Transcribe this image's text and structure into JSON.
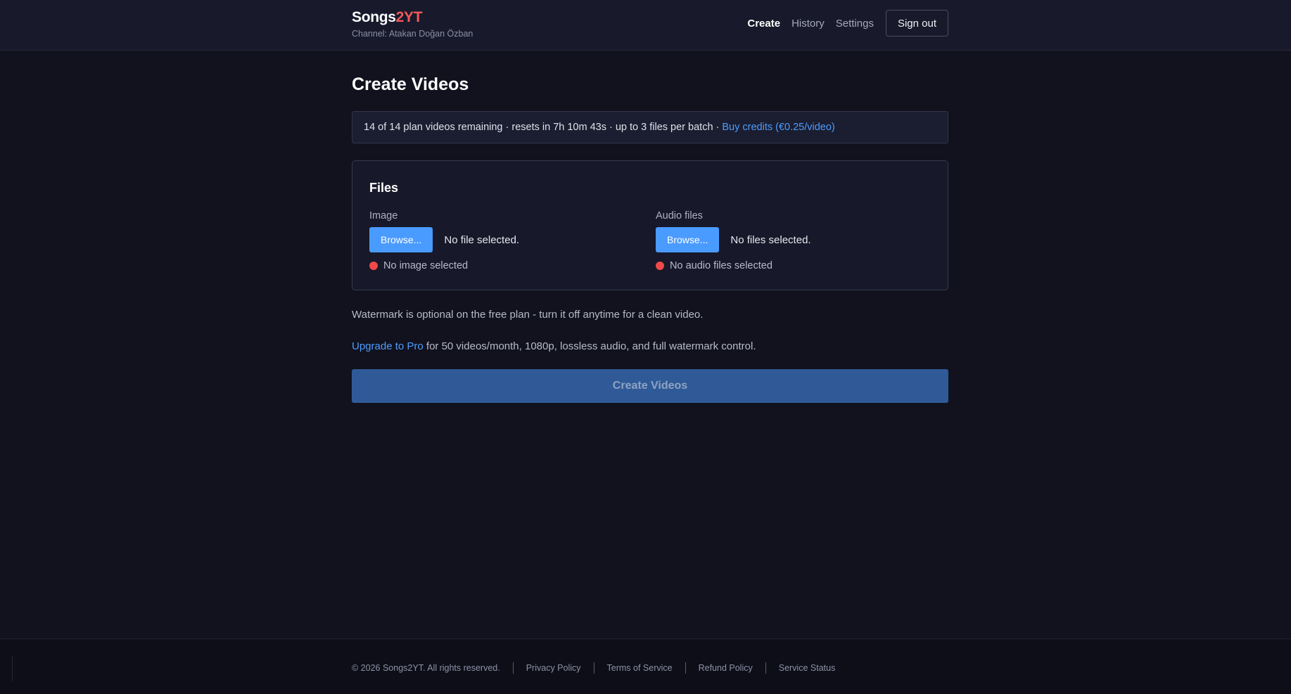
{
  "header": {
    "brand_main": "Songs",
    "brand_accent": "2YT",
    "channel": "Channel: Atakan Doğan Özban",
    "nav": [
      "Create",
      "History",
      "Settings"
    ],
    "sign_out": "Sign out"
  },
  "main": {
    "title": "Create Videos",
    "quota_text": "14 of 14 plan videos remaining · resets in 7h 10m 43s · up to 3 files per batch ·",
    "quota_link": "Buy credits (€0.25/video)",
    "files": {
      "title": "Files",
      "image": {
        "label": "Image",
        "browse": "Browse...",
        "status": "No file selected.",
        "warning": "No image selected"
      },
      "audio": {
        "label": "Audio files",
        "browse": "Browse...",
        "status": "No files selected.",
        "warning": "No audio files selected"
      }
    },
    "watermark_note": "Watermark is optional on the free plan - turn it off anytime for a clean video.",
    "upgrade_link": "Upgrade to Pro",
    "upgrade_text": " for 50 videos/month, 1080p, lossless audio, and full watermark control.",
    "create_button": "Create Videos"
  },
  "footer": {
    "copyright": "© 2026 Songs2YT. All rights reserved.",
    "links": [
      "Privacy Policy",
      "Terms of Service",
      "Refund Policy",
      "Service Status"
    ]
  },
  "colors": {
    "accent_red": "#ef5a5a",
    "link_blue": "#4d9dff",
    "button_blue": "#4a9bff",
    "warning_dot": "#ef4a4a"
  }
}
